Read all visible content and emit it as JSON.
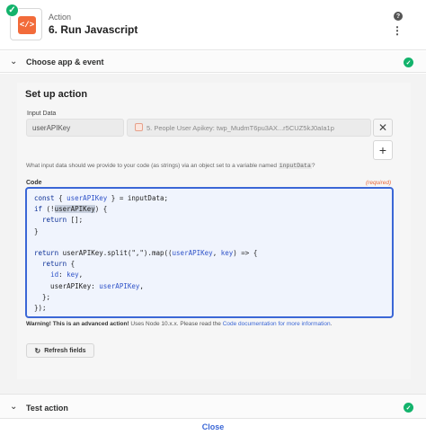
{
  "step": {
    "kicker": "Action",
    "title": "6. Run Javascript",
    "icon_text": "</>",
    "icon": "code-app-icon",
    "status": "complete"
  },
  "header_icons": {
    "help": "?",
    "more": "⋮"
  },
  "sections": {
    "choose": {
      "label": "Choose app & event",
      "expanded": false,
      "complete": true
    },
    "test": {
      "label": "Test action",
      "expanded": false,
      "complete": true
    }
  },
  "setup": {
    "title": "Set up action",
    "input_data_label": "Input Data",
    "rows": [
      {
        "key": "userAPIKey",
        "value_prefix": "5. People User Apikey:",
        "value_sample": "twp_MudmT6pu3AX...r5CUZ5kJ0aIa1p"
      }
    ],
    "add_label": "+",
    "remove_label": "✕",
    "help_text_before": "What input data should we provide to your code (as strings) via an object set to a variable named",
    "help_code": "inputData",
    "help_text_after": "?",
    "code_label": "Code",
    "required_label": "(required)",
    "code": [
      "const { userAPIKey } = inputData;",
      "if (!userAPIKey) {",
      "  return [];",
      "}",
      "",
      "return userAPIKey.split(\",\").map((userAPIKey, key) => {",
      "  return {",
      "    id: key,",
      "    userAPIKey: userAPIKey,",
      "  };",
      "});"
    ],
    "warning_bold": "Warning! This is an advanced action!",
    "warning_text": " Uses Node 10.x.x. Please read the ",
    "warning_link": "Code documentation for more information",
    "warning_end": ".",
    "refresh_label": "Refresh fields"
  },
  "footer": {
    "close_label": "Close"
  },
  "colors": {
    "accent": "#3b67d6",
    "success": "#13b36c",
    "brand": "#f26b3a",
    "required": "#e8693b"
  }
}
